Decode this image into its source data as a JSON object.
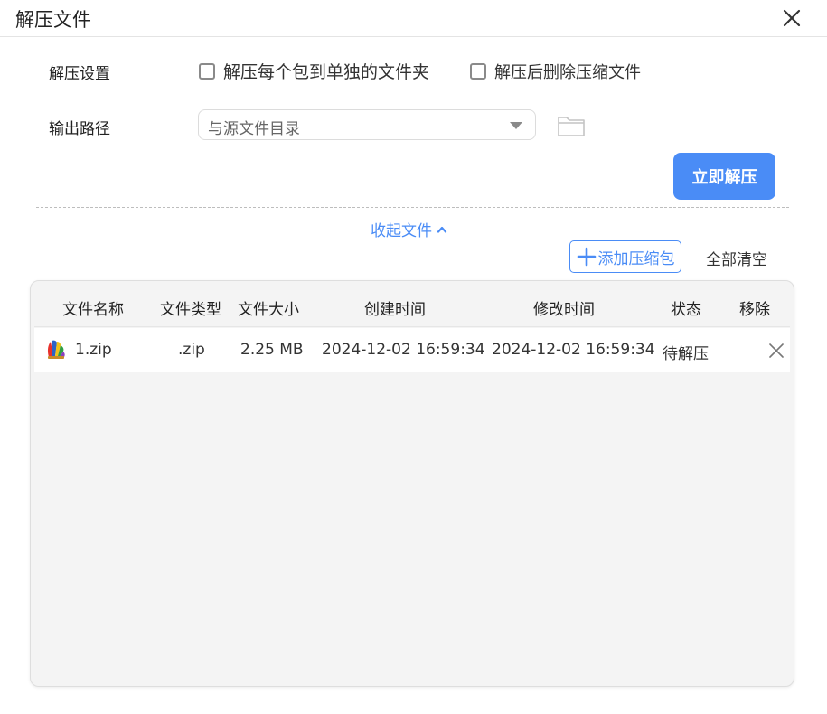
{
  "window": {
    "title": "解压文件"
  },
  "settings": {
    "label": "解压设置",
    "option_separate_folder": "解压每个包到单独的文件夹",
    "option_delete_after": "解压后删除压缩文件"
  },
  "output": {
    "label": "输出路径",
    "selected": "与源文件目录"
  },
  "actions": {
    "extract_now": "立即解压",
    "collapse_files": "收起文件",
    "add_archive": "添加压缩包",
    "clear_all": "全部清空"
  },
  "table": {
    "headers": {
      "name": "文件名称",
      "type": "文件类型",
      "size": "文件大小",
      "created": "创建时间",
      "modified": "修改时间",
      "status": "状态",
      "remove": "移除"
    },
    "rows": [
      {
        "name": "1.zip",
        "type": ".zip",
        "size": "2.25 MB",
        "created": "2024-12-02 16:59:34",
        "modified": "2024-12-02 16:59:34",
        "status": "待解压"
      }
    ]
  },
  "colors": {
    "accent": "#4a8cf6",
    "panel_bg": "#f4f4f4"
  },
  "icons": {
    "close": "close-icon",
    "folder": "folder-icon",
    "caret": "caret-down-icon",
    "chevron": "chevron-up-icon",
    "plus": "plus-icon",
    "zip": "zip-archive-icon"
  }
}
